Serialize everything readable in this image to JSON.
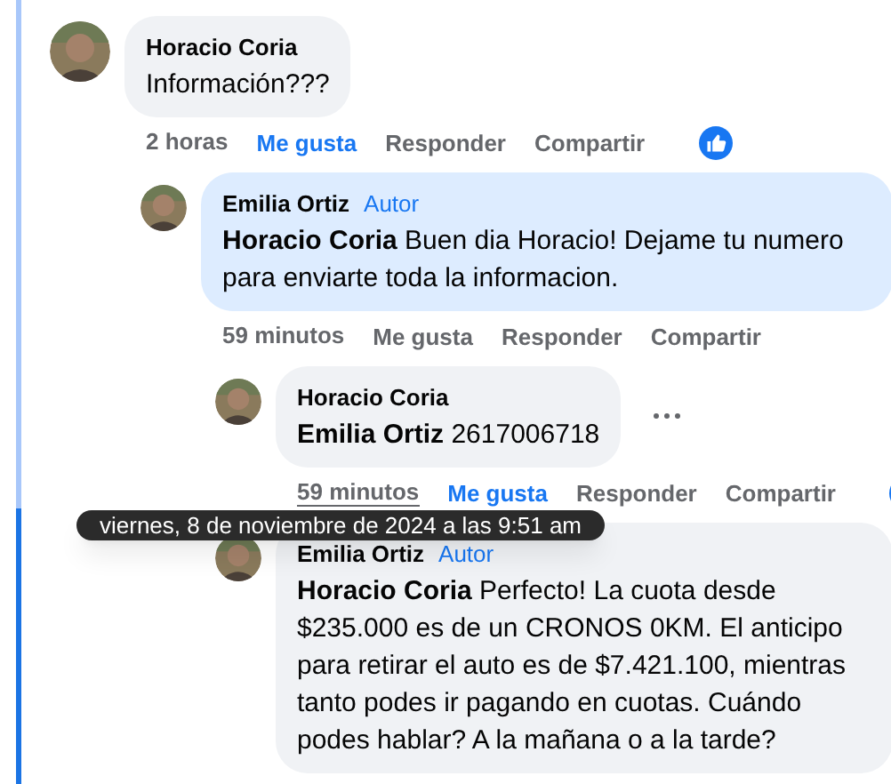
{
  "comments": [
    {
      "author": "Horacio Coria",
      "text": "Información???",
      "time": "2 horas",
      "liked": true,
      "reacted": true,
      "highlighted": false,
      "hovered": false,
      "more": false,
      "actions": [
        "Me gusta",
        "Responder",
        "Compartir"
      ],
      "children": [
        {
          "author": "Emilia Ortiz",
          "badge": "Autor",
          "mention": "Horacio Coria",
          "text": "Buen dia Horacio! Dejame tu numero para enviarte toda la informacion.",
          "time": "59 minutos",
          "liked": false,
          "reacted": false,
          "highlighted": true,
          "hovered": false,
          "more": false,
          "actions": [
            "Me gusta",
            "Responder",
            "Compartir"
          ],
          "children": [
            {
              "author": "Horacio Coria",
              "mention": "Emilia Ortiz",
              "text": "2617006718",
              "time": "59 minutos",
              "liked": true,
              "reacted": true,
              "highlighted": false,
              "hovered": true,
              "more": true,
              "actions": [
                "Me gusta",
                "Responder",
                "Compartir"
              ]
            },
            {
              "author": "Emilia Ortiz",
              "badge": "Autor",
              "mention": "Horacio Coria",
              "text": "Perfecto! La cuota desde $235.000 es de un CRONOS 0KM. El anticipo para retirar el auto es de $7.421.100, mientras tanto podes ir pagando en cuotas. Cuándo podes hablar? A la mañana o a la tarde?",
              "highlighted": false,
              "more": false
            }
          ]
        }
      ]
    }
  ],
  "tooltip": {
    "text": "viernes, 8 de noviembre de 2024 a las 9:51 am"
  }
}
